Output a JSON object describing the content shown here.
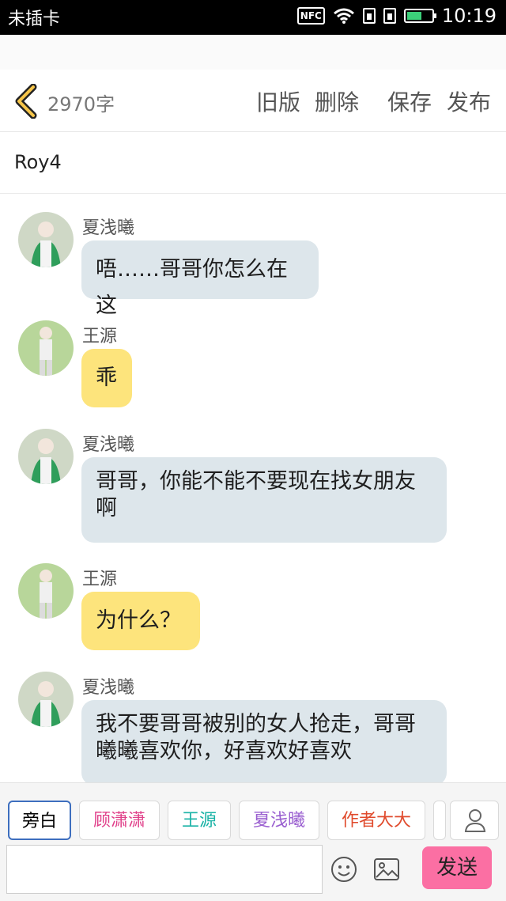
{
  "status_bar": {
    "carrier": "未插卡",
    "nfc": "NFC",
    "time": "10:19"
  },
  "toolbar": {
    "word_count": "2970字",
    "old_version": "旧版",
    "delete": "删除",
    "save": "保存",
    "publish": "发布"
  },
  "title": "Roy4",
  "messages": [
    {
      "sender": "夏浅曦",
      "text": "唔……哥哥你怎么在这"
    },
    {
      "sender": "王源",
      "text": "乖"
    },
    {
      "sender": "夏浅曦",
      "text": "哥哥，你能不能不要现在找女朋友啊"
    },
    {
      "sender": "王源",
      "text": "为什么？"
    },
    {
      "sender": "夏浅曦",
      "text": "我不要哥哥被别的女人抢走，哥哥曦曦喜欢你，好喜欢好喜欢"
    }
  ],
  "characters": [
    {
      "label": "旁白",
      "color": "#666666"
    },
    {
      "label": "顾潇潇",
      "color": "#e0408a"
    },
    {
      "label": "王源",
      "color": "#1ab3a6"
    },
    {
      "label": "夏浅曦",
      "color": "#9a5fd0"
    },
    {
      "label": "作者大大",
      "color": "#e04a2c"
    }
  ],
  "composer": {
    "send_label": "发送",
    "input_value": ""
  },
  "icons": {
    "back": "chevron-left-icon",
    "emoji": "smiley-icon",
    "image": "image-icon",
    "person": "person-icon"
  }
}
